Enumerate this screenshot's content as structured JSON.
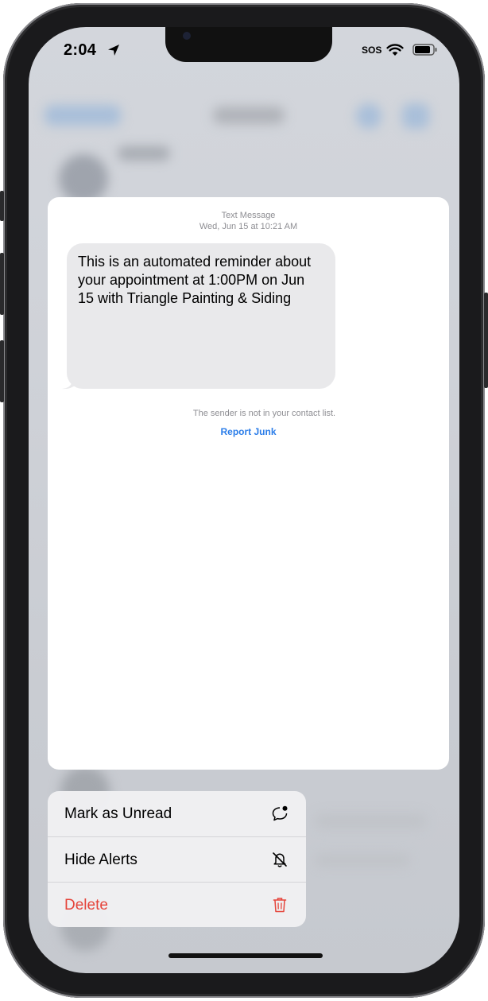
{
  "status_bar": {
    "time": "2:04",
    "carrier": "SOS",
    "icons": [
      "location-arrow-icon",
      "wifi-icon",
      "battery-icon"
    ]
  },
  "message_card": {
    "type_label": "Text Message",
    "timestamp": "Wed, Jun 15 at 10:21 AM",
    "bubble_text": "This is an automated reminder about your appointment at 1:00PM on Jun 15 with Triangle Painting & Siding",
    "sender_note": "The sender is not in your contact list.",
    "report_junk_label": "Report Junk"
  },
  "context_menu": {
    "items": [
      {
        "label": "Mark as Unread",
        "icon": "mark-unread-icon"
      },
      {
        "label": "Hide Alerts",
        "icon": "bell-slash-icon"
      },
      {
        "label": "Delete",
        "icon": "trash-icon",
        "destructive": true
      }
    ]
  },
  "colors": {
    "link_blue": "#2b7de9",
    "destructive_red": "#e5443a",
    "bubble_gray": "#e9e9eb"
  }
}
